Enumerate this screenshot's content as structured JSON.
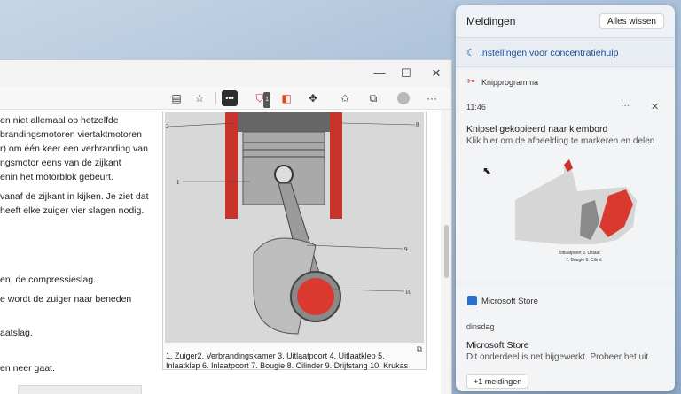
{
  "browser": {
    "toolbar_icons": [
      "reader-icon",
      "favorite-add-icon",
      "extension-icon",
      "shield-icon",
      "office-icon",
      "puzzle-icon",
      "favorites-icon",
      "collections-icon",
      "profile-icon",
      "more-icon"
    ],
    "badge_count": "1",
    "window_controls": {
      "minimize": "—",
      "maximize": "☐",
      "close": "✕"
    },
    "paragraphs": [
      "en niet allemaal op hetzelfde",
      "brandingsmotoren viertaktmotoren",
      "r) om één keer een verbranding van",
      "ngsmotor eens van de zijkant",
      "enin het motorblok gebeurt.",
      "vanaf de zijkant in kijken. Je ziet dat",
      "heeft elke zuiger vier slagen nodig.",
      "en, de compressieslag.",
      "e wordt de zuiger naar beneden",
      "aatslag.",
      "en neer gaat."
    ],
    "figure": {
      "labels": [
        "2",
        "8",
        "1",
        "9",
        "10"
      ],
      "caption_line1": "1. Zuiger2. Verbrandingskamer 3. Uitlaatpoort 4. Uitlaatklep 5.",
      "caption_line2": "Inlaatklep 6. Inlaatpoort 7. Bougie 8. Cilinder 9. Drijfstang 10. Krukas"
    }
  },
  "notifications": {
    "title": "Meldingen",
    "clear_all": "Alles wissen",
    "focus_assist": "Instellingen voor concentratiehulp",
    "snip": {
      "app": "Knipprogramma",
      "time": "11:46",
      "more": "···",
      "close": "✕",
      "title": "Knipsel gekopieerd naar klembord",
      "body": "Klik hier om de afbeelding te markeren en delen",
      "preview_caption_1": "Uitlaatpoort 3. Uitlaat",
      "preview_caption_2": "7. Bougie 8. Cilind"
    },
    "store": {
      "app": "Microsoft Store",
      "day": "dinsdag",
      "title": "Microsoft Store",
      "body": "Dit onderdeel is net bijgewerkt. Probeer het uit."
    },
    "more_button": "+1 meldingen"
  }
}
